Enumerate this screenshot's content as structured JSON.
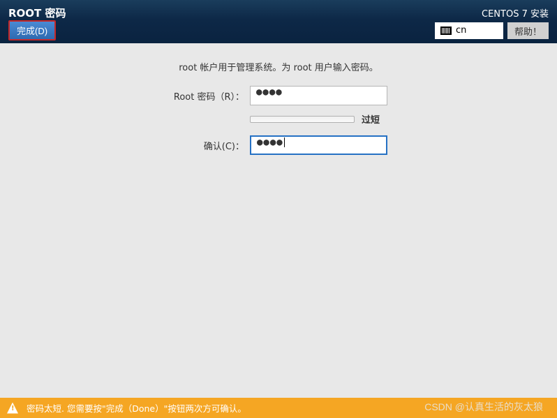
{
  "header": {
    "title": "ROOT 密码",
    "installer": "CENTOS 7 安装",
    "done_button": "完成(D)",
    "language": "cn",
    "help_button": "帮助！"
  },
  "main": {
    "instruction": "root 帐户用于管理系统。为 root 用户输入密码。",
    "password_label": "Root 密码（R）：",
    "password_value": "●●●●",
    "confirm_label": "确认(C)：",
    "confirm_value": "●●●●",
    "strength_text": "过短"
  },
  "footer": {
    "warning": "密码太短. 您需要按\"完成（Done）\"按钮两次方可确认。"
  },
  "watermark": "CSDN @认真生活的灰太狼"
}
